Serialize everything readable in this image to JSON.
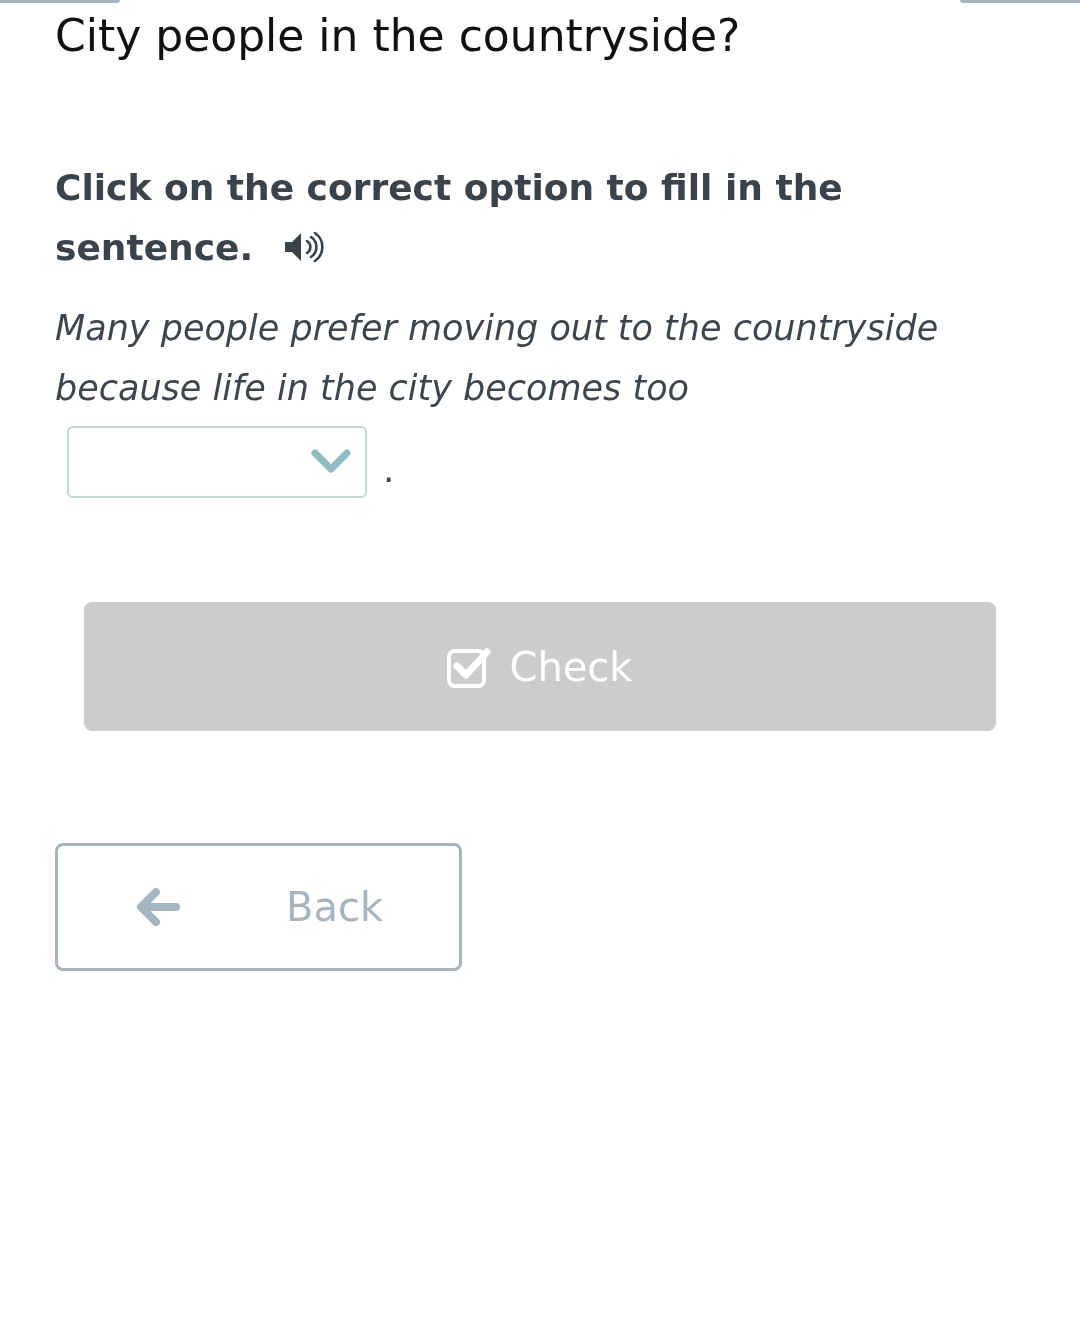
{
  "title": "City people in the countryside?",
  "instruction": "Click on the correct option to fill in the sentence.",
  "sentence": "Many people prefer moving out to the countryside because life in the city becomes too",
  "gap": {
    "expanded": false
  },
  "gap_end": ".",
  "check_button": {
    "label": "Check",
    "disabled": true
  },
  "back_button": {
    "label": "Back"
  }
}
